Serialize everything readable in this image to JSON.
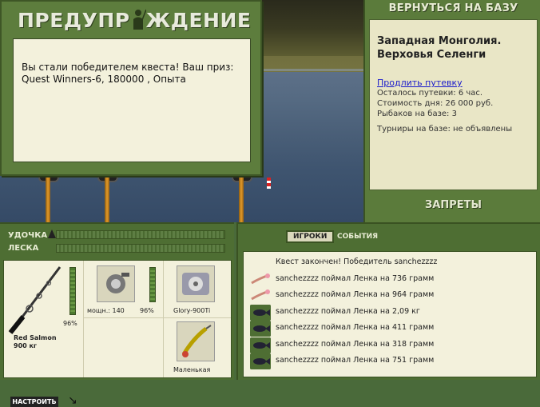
{
  "popup": {
    "title_part1": "ПРЕДУПР",
    "title_part2": "ЖДЕНИЕ",
    "message_line1": "Вы стали победителем квеста! Ваш приз:",
    "message_line2": "Quest Winners-6, 180000 , Опыта"
  },
  "base": {
    "back_button": "ВЕРНУТЬСЯ НА БАЗУ",
    "location_line1": "Западная Монголия.",
    "location_line2": "Верховья Селенги",
    "extend_link": "Продлить путевку",
    "remaining": "Осталось путевки: 6 час.",
    "day_cost": "Стоимость дня: 26 000 руб.",
    "anglers": "Рыбаков на базе: 3",
    "tournaments": "Турниры на базе: не объявлены",
    "bans": "ЗАПРЕТЫ"
  },
  "meters": {
    "rod_label": "УДОЧКА",
    "line_label": "ЛЕСКА"
  },
  "gear": {
    "rod_percent": "96%",
    "rod_name": "Red Salmon",
    "rod_weight": "900 кг",
    "reel_power": "мощн.: 140",
    "reel_percent": "96%",
    "line_name": "Glory-900Ti",
    "lure_name": "Маленькая",
    "configure_button": "НАСТРОИТЬ"
  },
  "events": {
    "tab_players": "ИГРОКИ",
    "tab_events": "СОБЫТИЯ",
    "rows": [
      {
        "icon": "none",
        "text": "Квест закончен! Победитель sanchezzzz"
      },
      {
        "icon": "lure",
        "text": "sanchezzzz поймал Ленка на 736 грамм"
      },
      {
        "icon": "lure",
        "text": "sanchezzzz поймал Ленка на 964 грамм"
      },
      {
        "icon": "fish",
        "text": "sanchezzzz поймал Ленка на 2,09 кг"
      },
      {
        "icon": "fish",
        "text": "sanchezzzz поймал Ленка на 411 грамм"
      },
      {
        "icon": "fish",
        "text": "sanchezzzz поймал Ленка на 318 грамм"
      },
      {
        "icon": "fish",
        "text": "sanchezzzz поймал Ленка на 751 грамм"
      }
    ]
  }
}
